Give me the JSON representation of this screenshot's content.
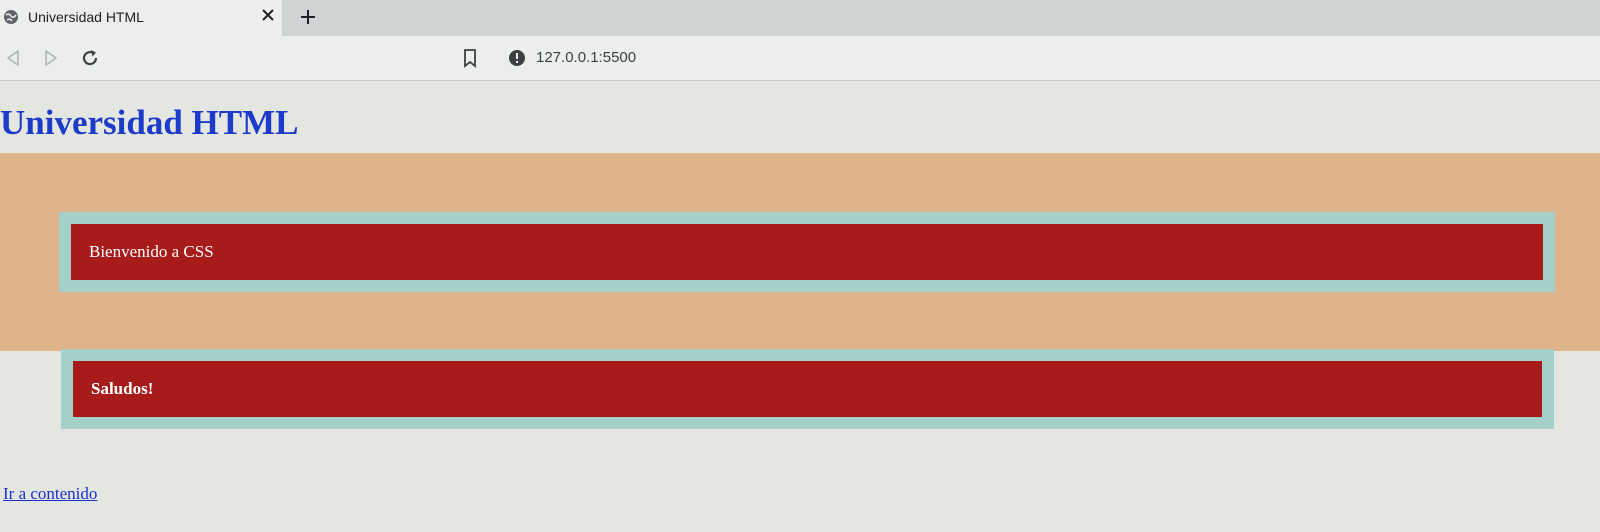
{
  "browser": {
    "tab": {
      "title": "Universidad HTML",
      "favicon": "globe-icon"
    },
    "toolbar": {
      "url": "127.0.0.1:5500"
    }
  },
  "page": {
    "title": "Universidad HTML",
    "box1_text": "Bienvenido a CSS",
    "box2_text": "Saludos!",
    "link_text": "Ir a contenido"
  },
  "colors": {
    "title": "#1c3bc9",
    "band": "#e0b48b",
    "box_border": "#a5d0c9",
    "box_fill": "#a71c1b",
    "link": "#1a2fd0"
  }
}
